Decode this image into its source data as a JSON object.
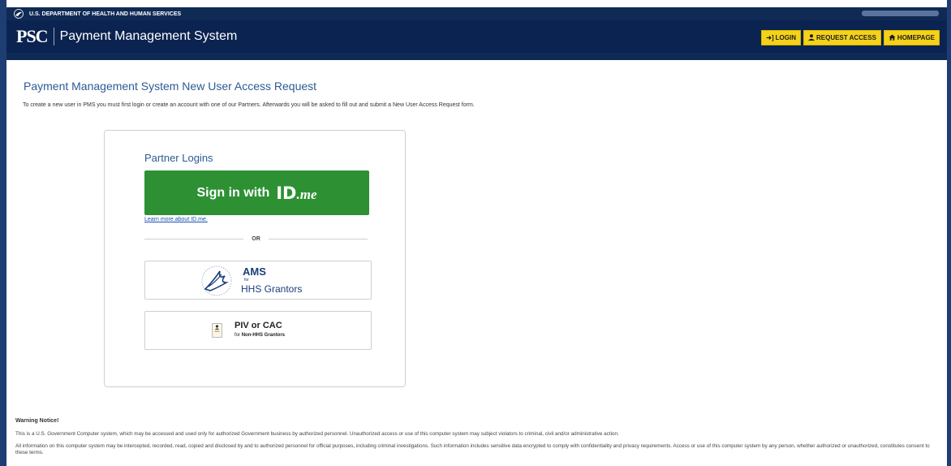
{
  "top_bar": {
    "department": "U.S. DEPARTMENT OF HEALTH AND HUMAN SERVICES"
  },
  "header": {
    "logo": "PSC",
    "title": "Payment Management System",
    "nav": {
      "login": "LOGIN",
      "request_access": "REQUEST ACCESS",
      "homepage": "HOMEPAGE"
    }
  },
  "page": {
    "title": "Payment Management System New User Access Request",
    "intro": "To create a new user in PMS you must first login or create an account with one of our Partners. Afterwards you will be asked to fill out and submit a New User Access Request form."
  },
  "partner_card": {
    "heading": "Partner Logins",
    "idme_sign_in": "Sign in with",
    "idme_brand_id": "ID",
    "idme_brand_me": ".me",
    "learn_more": "Learn more about ID.me.",
    "divider": "OR",
    "ams": {
      "title": "AMS",
      "for": "for",
      "subtitle": "HHS Grantors"
    },
    "piv": {
      "title": "PIV or CAC",
      "for": "for",
      "subtitle": "Non-HHS Grantors"
    }
  },
  "warning": {
    "title": "Warning Notice!",
    "p1": "This is a U.S. Government Computer system, which may be accessed and used only for authorized Government business by authorized personnel. Unauthorized access or use of this computer system may subject violators to criminal, civil and/or administrative action.",
    "p2": "All information on this computer system may be intercepted, recorded, read, copied and disclosed by and to authorized personnel for official purposes, including criminal investigations. Such information includes sensitive data encrypted to comply with confidentiality and privacy requirements. Access or use of this computer system by any person, whether authorized or unauthorized, constitutes consent to these terms."
  },
  "colors": {
    "header_bg": "#0b2350",
    "nav_button": "#f4d21a",
    "idme_green": "#2d9134",
    "link_blue": "#2b5b93"
  },
  "icons": [
    "hhs-eagle-icon",
    "login-icon",
    "user-icon",
    "home-icon",
    "hhs-seal-icon",
    "id-card-icon"
  ]
}
